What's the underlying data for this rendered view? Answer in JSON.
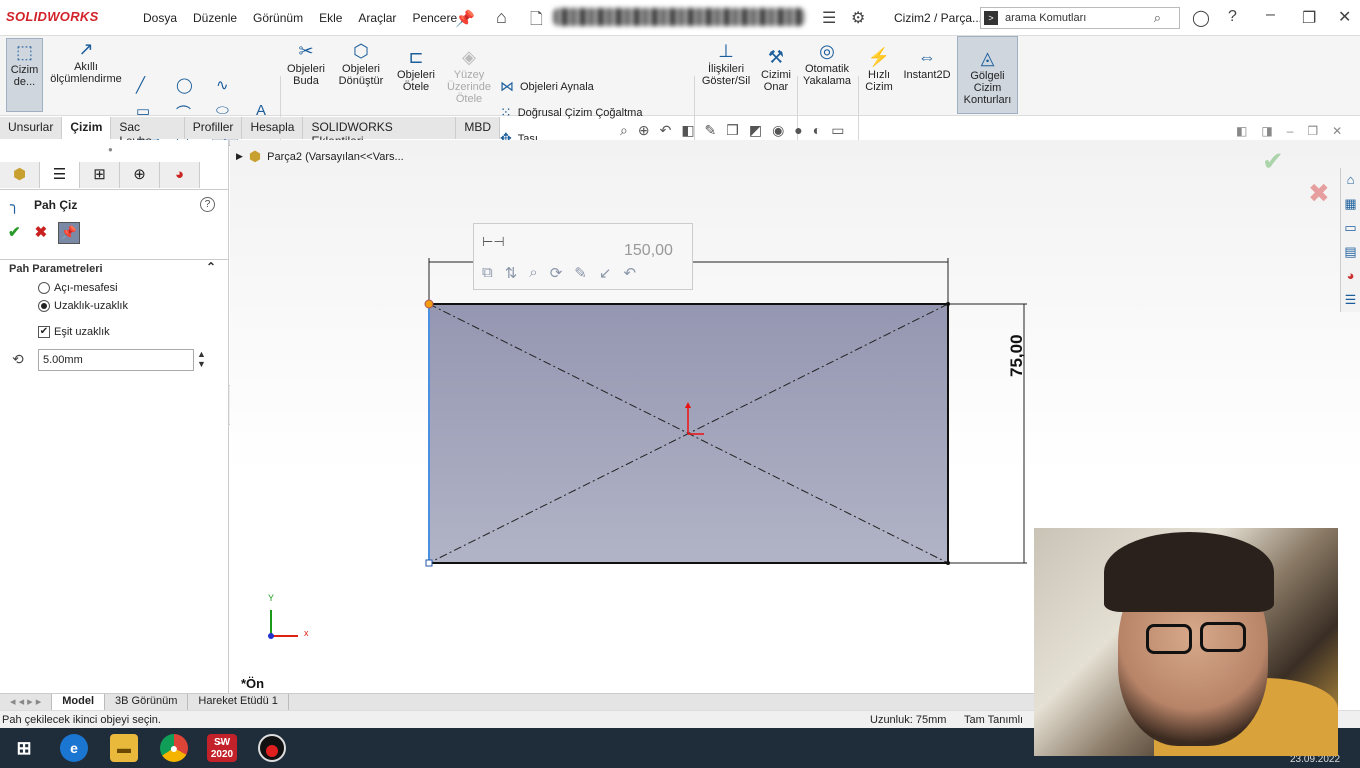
{
  "app": {
    "logo": "SOLIDWORKS",
    "doc_title": "Cizim2 / Parça...",
    "search_placeholder": "arama Komutları"
  },
  "menu": [
    "Dosya",
    "Düzenle",
    "Görünüm",
    "Ekle",
    "Araçlar",
    "Pencere"
  ],
  "ribbon": {
    "cizim_de": "Cizim de...",
    "akilli": "Akıllı ölçümlendirme",
    "buda": "Objeleri Buda",
    "donustur": "Objeleri Dönüştür",
    "otele": "Objeleri Ötele",
    "yuzey": "Yüzey Üzerinde Ötele",
    "aynala": "Objeleri Aynala",
    "cogaltma": "Doğrusal Çizim Çoğaltma",
    "tasi": "Taşı",
    "iliskiler": "İlişkileri Göster/Sil",
    "onar": "Cizimi Onar",
    "yakalama": "Otomatik Yakalama",
    "hizli": "Hızlı Cizim",
    "instant": "Instant2D",
    "golgeli": "Gölgeli Cizim Konturları"
  },
  "tabs": [
    "Unsurlar",
    "Çizim",
    "Sac Levha",
    "Profiller",
    "Hesapla",
    "SOLIDWORKS Eklentileri",
    "MBD"
  ],
  "propmgr": {
    "title": "Pah Çiz",
    "group": "Pah Parametreleri",
    "opt1": "Açı-mesafesi",
    "opt2": "Uzaklık-uzaklık",
    "equal": "Eşit uzaklık",
    "distance": "5.00mm"
  },
  "tree": {
    "label": "Parça2  (Varsayılan<<Vars..."
  },
  "sketch": {
    "dim_h": "150,00",
    "dim_v": "75,00",
    "view": "*Ön",
    "axis_x": "x",
    "axis_y": "Y"
  },
  "bottom_tabs": [
    "Model",
    "3B Görünüm",
    "Hareket Etüdü 1"
  ],
  "status": {
    "msg": "Pah çekilecek ikinci objeyi seçin.",
    "length": "Uzunluk: 75mm",
    "state": "Tam Tanımlı"
  },
  "taskbar": {
    "sw_label": "2020",
    "date": "23.09.2022"
  },
  "colors": {
    "accent": "#1c5e9c",
    "fill": "#a3a6bd",
    "brand": "#d2232a"
  }
}
